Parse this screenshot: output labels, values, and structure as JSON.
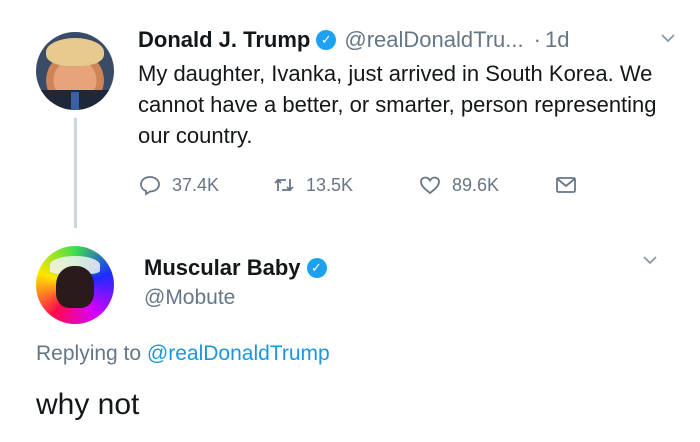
{
  "original_tweet": {
    "display_name": "Donald J. Trump",
    "handle": "@realDonaldTru...",
    "time": "1d",
    "text": "My daughter, Ivanka, just arrived in South Korea. We cannot have a better, or smarter, person representing our country.",
    "replies": "37.4K",
    "retweets": "13.5K",
    "likes": "89.6K"
  },
  "reply_tweet": {
    "display_name": "Muscular Baby",
    "handle": "@Mobute",
    "replying_prefix": "Replying to",
    "replying_to": "@realDonaldTrump",
    "text": "why not"
  },
  "colors": {
    "verified": "#1da1f2",
    "secondary_text": "#657786",
    "link": "#1b95e0"
  },
  "icons": [
    "verified-badge-icon",
    "chevron-down-icon",
    "reply-icon",
    "retweet-icon",
    "like-icon",
    "direct-message-icon"
  ]
}
